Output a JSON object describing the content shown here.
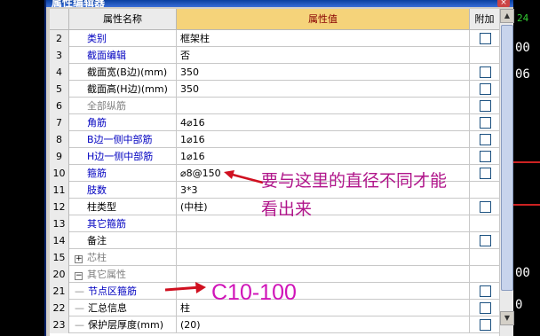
{
  "window": {
    "title": "属性编辑器",
    "close_label": "×"
  },
  "grid": {
    "headers": {
      "name": "属性名称",
      "value": "属性值",
      "attach": "附加"
    },
    "rows": [
      {
        "num": "2",
        "name": "类别",
        "value": "框架柱",
        "style": "blue",
        "checkbox": true
      },
      {
        "num": "3",
        "name": "截面编辑",
        "value": "否",
        "style": "blue",
        "checkbox": false
      },
      {
        "num": "4",
        "name": "截面宽(B边)(mm)",
        "value": "350",
        "style": "black",
        "checkbox": true
      },
      {
        "num": "5",
        "name": "截面高(H边)(mm)",
        "value": "350",
        "style": "black",
        "checkbox": true
      },
      {
        "num": "6",
        "name": "全部纵筋",
        "value": "",
        "style": "gray",
        "checkbox": true
      },
      {
        "num": "7",
        "name": "角筋",
        "value": "4⌀16",
        "style": "blue",
        "checkbox": true
      },
      {
        "num": "8",
        "name": "B边一侧中部筋",
        "value": "1⌀16",
        "style": "blue",
        "checkbox": true
      },
      {
        "num": "9",
        "name": "H边一侧中部筋",
        "value": "1⌀16",
        "style": "blue",
        "checkbox": true
      },
      {
        "num": "10",
        "name": "箍筋",
        "value": "⌀8@150",
        "style": "blue",
        "checkbox": true
      },
      {
        "num": "11",
        "name": "肢数",
        "value": "3*3",
        "style": "blue",
        "checkbox": false
      },
      {
        "num": "12",
        "name": "柱类型",
        "value": "(中柱)",
        "style": "black",
        "checkbox": true
      },
      {
        "num": "13",
        "name": "其它箍筋",
        "value": "",
        "style": "blue",
        "checkbox": false
      },
      {
        "num": "14",
        "name": "备注",
        "value": "",
        "style": "black",
        "checkbox": true
      },
      {
        "num": "15",
        "name": "芯柱",
        "value": "",
        "style": "gray",
        "checkbox": false,
        "tree": "+"
      },
      {
        "num": "20",
        "name": "其它属性",
        "value": "",
        "style": "gray",
        "checkbox": false,
        "tree": "-"
      },
      {
        "num": "21",
        "name": "节点区箍筋",
        "value": "",
        "style": "blue",
        "checkbox": true,
        "child": true
      },
      {
        "num": "22",
        "name": "汇总信息",
        "value": "柱",
        "style": "black",
        "checkbox": true,
        "child": true
      },
      {
        "num": "23",
        "name": "保护层厚度(mm)",
        "value": "(20)",
        "style": "black",
        "checkbox": true,
        "child": true
      }
    ]
  },
  "annotations": {
    "note_line1": "要与这里的直径不同才能",
    "note_line2": "看出来",
    "big_label": "C10-100"
  },
  "cad": {
    "t1": "24",
    "t2": "00",
    "t3": "06",
    "t4": "00",
    "t5": "0"
  },
  "colors": {
    "annotation": "#b0158a",
    "header_value_bg": "#f5d37a",
    "link_blue": "#0000c0"
  }
}
